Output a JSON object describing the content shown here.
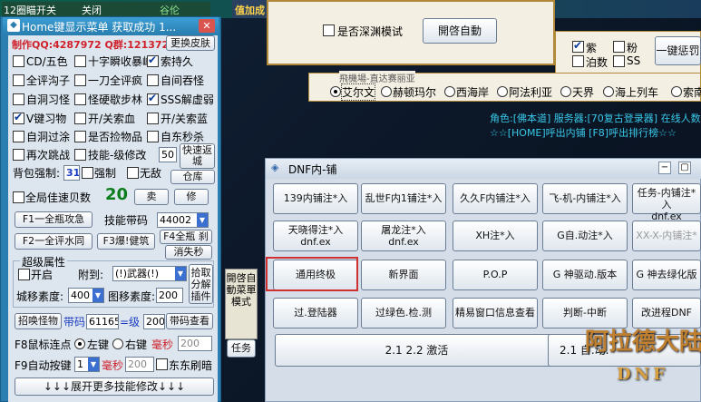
{
  "top_strip": {
    "left1": "12圈瞄开关",
    "left2": "关闭",
    "right1": "谷伦",
    "middle": "值加成"
  },
  "main_window": {
    "title": "Home键显示菜单 获取成功 1...",
    "author_line": "制作QQ:4287972 Q群:121372859",
    "hide_menu_label": "更换皮肤",
    "checkboxes": [
      {
        "label": "CD/五色",
        "checked": false
      },
      {
        "label": "十字瞬收暴峰",
        "checked": false
      },
      {
        "label": "索持久",
        "checked": true
      },
      {
        "label": "全评沟子",
        "checked": false
      },
      {
        "label": "一刀全评疯",
        "checked": false
      },
      {
        "label": "自间吞怪",
        "checked": false
      },
      {
        "label": "自洞习怪",
        "checked": false
      },
      {
        "label": "怪硬歇步林",
        "checked": false
      },
      {
        "label": "SSS解虚弱",
        "checked": true
      },
      {
        "label": "V键习物",
        "checked": true
      },
      {
        "label": "开/关索血",
        "checked": false
      },
      {
        "label": "开/关索蓝",
        "checked": false
      },
      {
        "label": "自洞过涂",
        "checked": false
      },
      {
        "label": "是否捡物品",
        "checked": false
      },
      {
        "label": "自东秒杀",
        "checked": false
      },
      {
        "label": "再次跳战",
        "checked": false
      },
      {
        "label": "技能-级修改",
        "checked": false
      }
    ],
    "skill_level_value": "50",
    "quick_return_label": "快速返\n城",
    "bag_label": "背包强制:",
    "bag_value": "31",
    "force_label": "强制",
    "no_enemy_label": "无敌",
    "warehouse_label": "仓库",
    "full_speed_label": "全局佳速贝数",
    "speed_value": "20",
    "sell_label": "卖",
    "repair_label": "修",
    "f1_label": "F1一全瓶攻急",
    "skill_lock_label": "技能带码",
    "skill_lock_value": "44002",
    "f2_label": "F2一全评水同",
    "f3_label": "F3爆!健筑",
    "f4_label": "F4全瓶 刹",
    "remove_label": "消失秒",
    "attr_section_label": "超级属性",
    "attr_open_label": "开启",
    "attr_add_label": "附到:",
    "attr_target_value": "(!)武器(!)",
    "pickup_label": "拾取\n分解\n插件",
    "city_speed_label": "城移素度:",
    "city_speed_value": "400",
    "map_speed_label": "图移素度:",
    "map_speed_value": "200",
    "summon_label": "招唤怪物",
    "summon_code_label": "带码",
    "summon_code_value": "61165",
    "level_label": "=级",
    "level_value": "200",
    "code_check_label": "带码查看",
    "f8_label": "F8鼠标连点",
    "left_key_label": "左键",
    "right_key_label": "右键",
    "ms_label": "毫秒",
    "f8_ms_value": "200",
    "f9_label": "F9自动按键",
    "f9_key_value": "1",
    "f9_ms_label": "毫秒",
    "f9_ms_value": "200",
    "no_refresh_label": "东东刷暗",
    "expand_label": "↓↓↓展开更多技能修改↓↓↓"
  },
  "top_dialog": {
    "checkbox_label": "是否深渊模试",
    "open_auto_label": "開啓自動"
  },
  "right_panel": {
    "opts": [
      {
        "label": "紫",
        "checked": true
      },
      {
        "label": "粉",
        "checked": false
      },
      {
        "label": "泊数",
        "checked": false
      },
      {
        "label": "SS",
        "checked": false
      }
    ],
    "one_key_label": "一键惩罚"
  },
  "channel_panel": {
    "title": "飛機場-直达赛丽亚",
    "channels": [
      {
        "label": "艾尔文",
        "selected": true
      },
      {
        "label": "赫顿玛尔",
        "selected": false
      },
      {
        "label": "西海岸",
        "selected": false
      },
      {
        "label": "阿法利亚",
        "selected": false
      },
      {
        "label": "天界",
        "selected": false
      },
      {
        "label": "海上列车",
        "selected": false
      },
      {
        "label": "索南",
        "selected": false
      }
    ]
  },
  "game_text": {
    "line1": "角色:[佛本道] 服务器:[70复古登录器] 在线人数",
    "line2": "☆☆[HOME]呼出内铺 [F8]呼出排行榜☆☆"
  },
  "side_tab": {
    "label": "開啓自動菜單模式",
    "task_label": "任务"
  },
  "dnf_window": {
    "title": "DNF内-铺",
    "rows": [
      [
        "139内铺注*入",
        "乱世F内1铺注*入",
        "久久F内铺注*入",
        "飞-机-内铺注*入",
        "任务-内铺注*入\ndnf.ex"
      ],
      [
        "天晓得注*入\ndnf.ex",
        "屠龙注*入\ndnf.ex",
        "XH注*入",
        "G自.动注*入",
        "XX-X-内铺注*入"
      ],
      [
        "通用终极",
        "新界面",
        "P.O.P",
        "G 神驱动.版本",
        "G 神去绿化版"
      ],
      [
        "过.登陆器",
        "过绿色.检.测",
        "精易窗口信息查看器",
        "判断-中断",
        "改进程DNF"
      ]
    ],
    "activate_label": "2.1 2.2 激活",
    "bottom_right_label": "2.1 自.动."
  },
  "logo": {
    "main": "阿拉德大陆",
    "sub": "DNF"
  }
}
